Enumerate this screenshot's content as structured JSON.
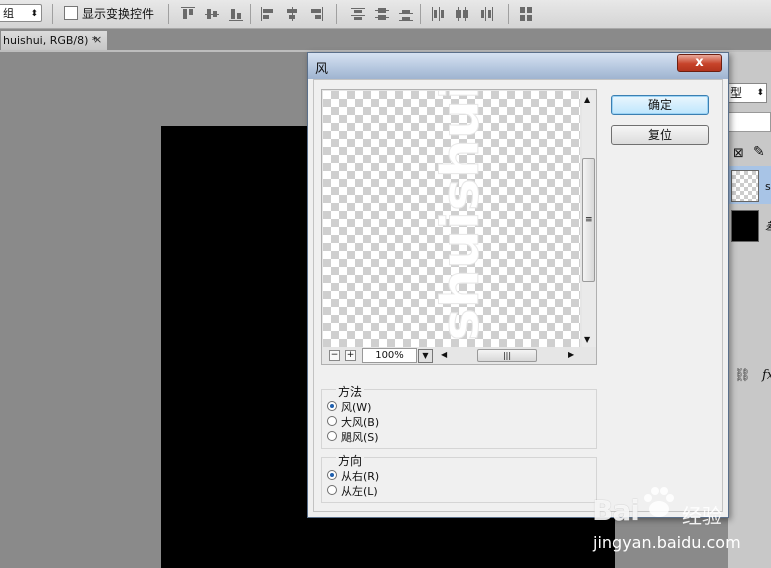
{
  "toolbar": {
    "group_select": "组",
    "show_transform_controls": "显示变换控件"
  },
  "document_tab": {
    "title": "huishui, RGB/8) *",
    "close": "×"
  },
  "dialog": {
    "title": "风",
    "close": "x",
    "ok": "确定",
    "reset": "复位",
    "zoom": "100%",
    "preview_text": "shuishui",
    "method_group": {
      "title": "方法",
      "options": [
        {
          "label": "风(W)",
          "selected": true
        },
        {
          "label": "大风(B)",
          "selected": false
        },
        {
          "label": "飓风(S)",
          "selected": false
        }
      ]
    },
    "direction_group": {
      "title": "方向",
      "options": [
        {
          "label": "从右(R)",
          "selected": true
        },
        {
          "label": "从左(L)",
          "selected": false
        }
      ]
    }
  },
  "layers_panel": {
    "kind_select": "型",
    "layer_1_label": "s",
    "layer_2_label": "差"
  },
  "watermark": {
    "logo": "Bai",
    "text": "经验",
    "url": "jingyan.baidu.com"
  }
}
